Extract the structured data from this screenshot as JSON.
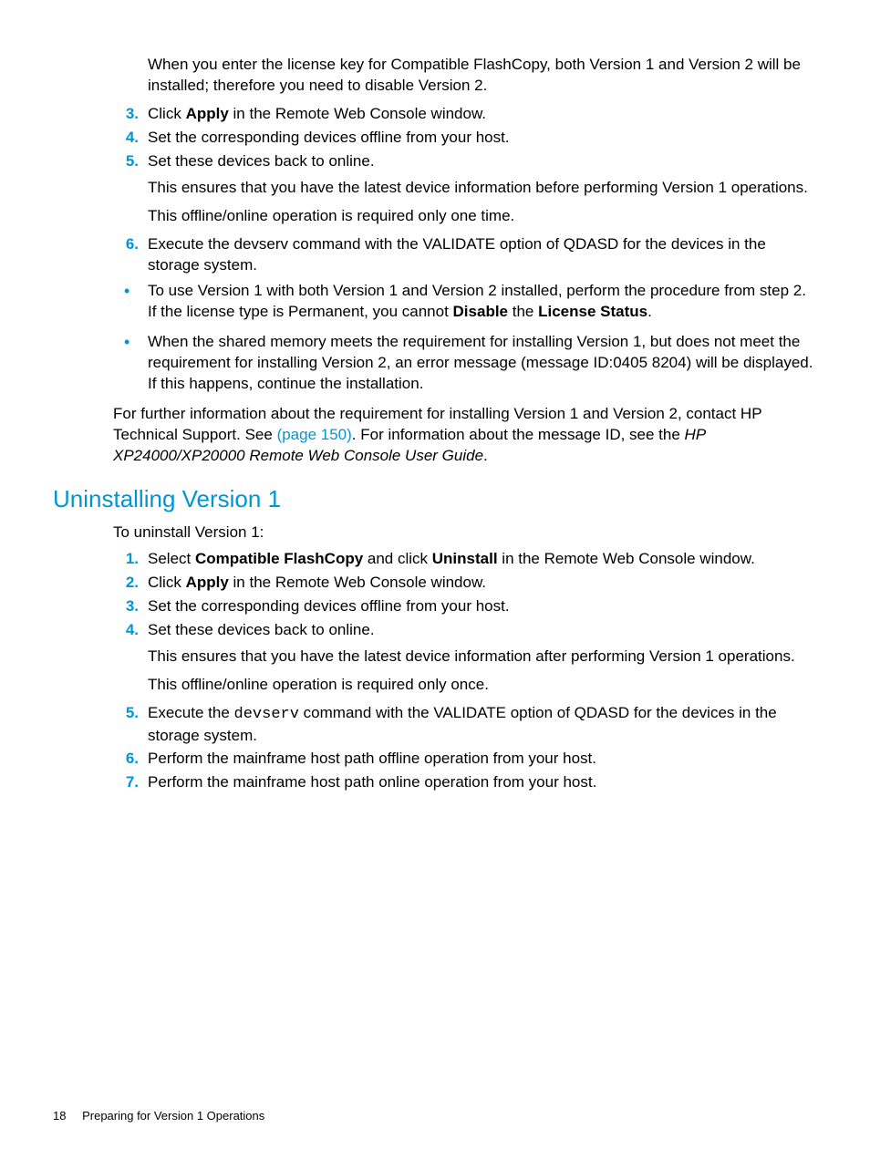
{
  "intro": "When you enter the license key for Compatible FlashCopy, both Version 1 and Version 2 will be installed; therefore you need to disable Version 2.",
  "steps1": {
    "s3": {
      "num": "3.",
      "pre": "Click ",
      "b1": "Apply",
      "post": " in the Remote Web Console window."
    },
    "s4": {
      "num": "4.",
      "text": "Set the corresponding devices offline from your host."
    },
    "s5": {
      "num": "5.",
      "text": "Set these devices back to online.",
      "sub1": "This ensures that you have the latest device information before performing Version 1 operations.",
      "sub2": "This offline/online operation is required only one time."
    },
    "s6": {
      "num": "6.",
      "text": "Execute the devserv command with the VALIDATE option of QDASD for the devices in the storage system."
    }
  },
  "bullets": {
    "b1": {
      "pre": "To use Version 1 with both Version 1 and Version 2 installed, perform the procedure from step 2. If the license type is Permanent, you cannot ",
      "bold1": "Disable",
      "mid": " the ",
      "bold2": "License Status",
      "post": "."
    },
    "b2": "When the shared memory meets the requirement for installing Version 1, but does not meet the requirement for installing Version 2, an error message (message ID:0405 8204) will be displayed. If this happens, continue the installation."
  },
  "closing": {
    "pre": "For further information about the requirement for installing Version 1 and Version 2, contact HP Technical Support. See ",
    "link": "(page 150)",
    "mid": ". For information about the message ID, see the ",
    "ital": "HP XP24000/XP20000 Remote Web Console User Guide",
    "post": "."
  },
  "section_title": "Uninstalling Version 1",
  "sec_intro": "To uninstall Version 1:",
  "steps2": {
    "s1": {
      "num": "1.",
      "pre": "Select ",
      "b1": "Compatible FlashCopy",
      "mid": " and click ",
      "b2": "Uninstall",
      "post": " in the Remote Web Console window."
    },
    "s2": {
      "num": "2.",
      "pre": "Click ",
      "b1": "Apply",
      "post": " in the Remote Web Console window."
    },
    "s3": {
      "num": "3.",
      "text": "Set the corresponding devices offline from your host."
    },
    "s4": {
      "num": "4.",
      "text": "Set these devices back to online.",
      "sub1": "This ensures that you have the latest device information after performing Version 1 operations.",
      "sub2": "This offline/online operation is required only once."
    },
    "s5": {
      "num": "5.",
      "pre": "Execute the ",
      "mono": "devserv",
      "post": " command with the VALIDATE option of QDASD for the devices in the storage system."
    },
    "s6": {
      "num": "6.",
      "text": "Perform the mainframe host path offline operation from your host."
    },
    "s7": {
      "num": "7.",
      "text": "Perform the mainframe host path online operation from your host."
    }
  },
  "footer": {
    "page": "18",
    "title": "Preparing for Version 1 Operations"
  }
}
